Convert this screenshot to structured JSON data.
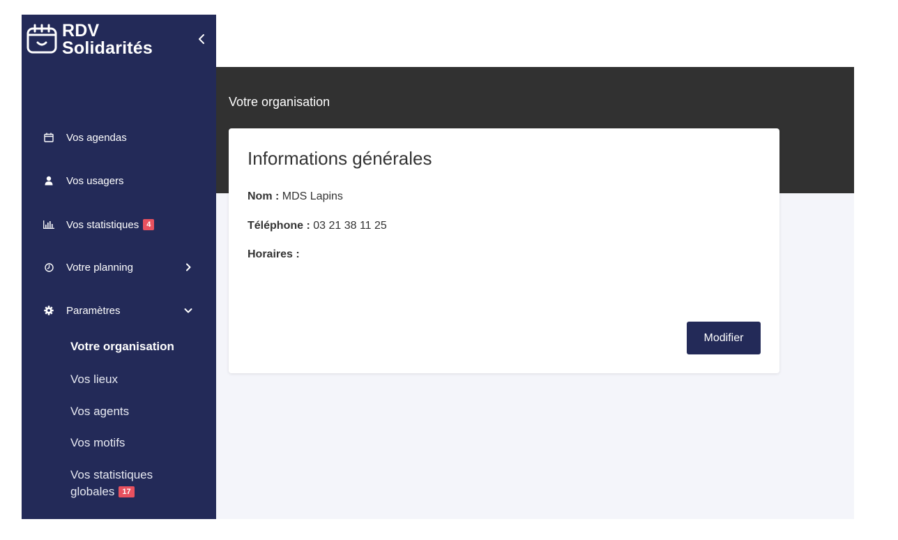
{
  "brand": {
    "line1": "RDV",
    "line2": "Solidarités",
    "icon": "calendar-smile-icon"
  },
  "sidebar": {
    "collapse_icon": "chevron-left-icon",
    "items": [
      {
        "label": "Vos agendas",
        "icon": "calendar-icon"
      },
      {
        "label": "Vos usagers",
        "icon": "user-icon"
      },
      {
        "label": "Vos statistiques",
        "icon": "bar-chart-icon",
        "badge": "4"
      },
      {
        "label": "Votre planning",
        "icon": "clock-icon",
        "arrow": "chevron-right-icon"
      },
      {
        "label": "Paramètres",
        "icon": "gear-icon",
        "arrow": "chevron-down-icon"
      }
    ],
    "sub_items": [
      {
        "label": "Votre organisation",
        "active": true
      },
      {
        "label": "Vos lieux"
      },
      {
        "label": "Vos agents"
      },
      {
        "label": "Vos motifs"
      },
      {
        "label_line1": "Vos statistiques",
        "label_line2": "globales",
        "badge": "17"
      }
    ]
  },
  "main": {
    "page_title": "Votre organisation",
    "card": {
      "title": "Informations générales",
      "nom_label": "Nom :",
      "nom_value": "MDS Lapins",
      "telephone_label": "Téléphone :",
      "telephone_value": "03 21 38 11 25",
      "horaires_label": "Horaires :",
      "horaires_value": "",
      "modify_button": "Modifier"
    }
  },
  "colors": {
    "sidebar_bg": "#232a58",
    "header_band": "#313131",
    "content_bg": "#f4f5fa",
    "badge": "#e8515f",
    "primary_button": "#232a58"
  }
}
